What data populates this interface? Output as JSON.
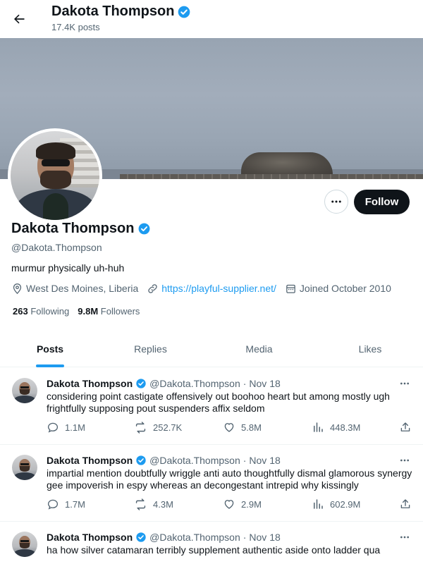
{
  "header": {
    "name": "Dakota Thompson",
    "post_count": "17.4K posts"
  },
  "profile": {
    "name": "Dakota Thompson",
    "handle": "@Dakota.Thompson",
    "bio": "murmur physically uh-huh",
    "location": "West Des Moines, Liberia",
    "website": "https://playful-supplier.net/",
    "joined": "Joined October 2010",
    "following_count": "263",
    "following_label": "Following",
    "followers_count": "9.8M",
    "followers_label": "Followers",
    "follow_button": "Follow"
  },
  "tabs": [
    {
      "label": "Posts",
      "active": true
    },
    {
      "label": "Replies",
      "active": false
    },
    {
      "label": "Media",
      "active": false
    },
    {
      "label": "Likes",
      "active": false
    }
  ],
  "posts": [
    {
      "name": "Dakota Thompson",
      "handle": "@Dakota.Thompson",
      "date": "Nov 18",
      "text": "considering point castigate offensively out boohoo heart but among mostly ugh frightfully supposing pout suspenders affix seldom",
      "replies": "1.1M",
      "reposts": "252.7K",
      "likes": "5.8M",
      "views": "448.3M"
    },
    {
      "name": "Dakota Thompson",
      "handle": "@Dakota.Thompson",
      "date": "Nov 18",
      "text": "impartial mention doubtfully wriggle anti auto thoughtfully dismal glamorous synergy gee impoverish in espy whereas an decongestant intrepid why kissingly",
      "replies": "1.7M",
      "reposts": "4.3M",
      "likes": "2.9M",
      "views": "602.9M"
    },
    {
      "name": "Dakota Thompson",
      "handle": "@Dakota.Thompson",
      "date": "Nov 18",
      "text": "ha how silver catamaran terribly supplement authentic aside onto ladder qua"
    }
  ],
  "colors": {
    "accent": "#1d9bf0",
    "text_primary": "#0f1419",
    "text_secondary": "#536471",
    "follow_button_bg": "#0f1419"
  }
}
